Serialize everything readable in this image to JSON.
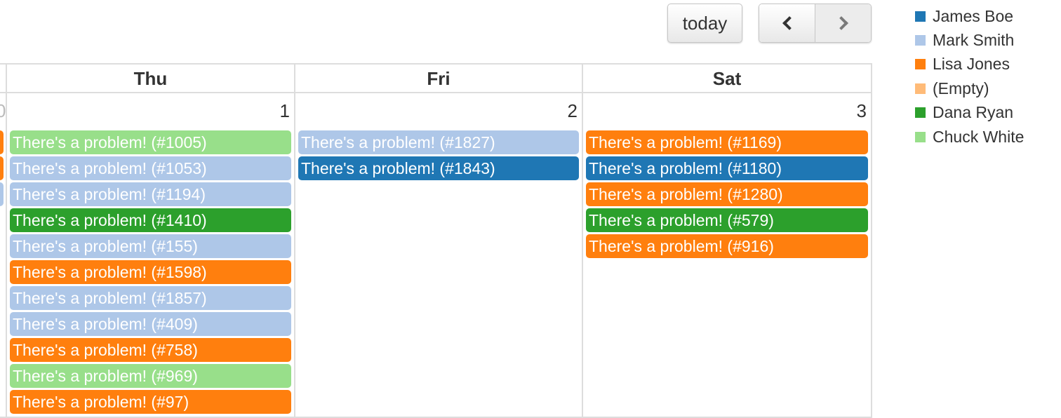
{
  "toolbar": {
    "today_label": "today",
    "prev_icon": "chevron-left",
    "next_icon": "chevron-right"
  },
  "calendar": {
    "columns": [
      {
        "day_name": "Thu",
        "day_number": "1",
        "events": [
          {
            "title": "There's a problem! (#1005)",
            "color": "#98df8a"
          },
          {
            "title": "There's a problem! (#1053)",
            "color": "#aec7e8"
          },
          {
            "title": "There's a problem! (#1194)",
            "color": "#aec7e8"
          },
          {
            "title": "There's a problem! (#1410)",
            "color": "#2ca02c"
          },
          {
            "title": "There's a problem! (#155)",
            "color": "#aec7e8"
          },
          {
            "title": "There's a problem! (#1598)",
            "color": "#ff7f0e"
          },
          {
            "title": "There's a problem! (#1857)",
            "color": "#aec7e8"
          },
          {
            "title": "There's a problem! (#409)",
            "color": "#aec7e8"
          },
          {
            "title": "There's a problem! (#758)",
            "color": "#ff7f0e"
          },
          {
            "title": "There's a problem! (#969)",
            "color": "#98df8a"
          },
          {
            "title": "There's a problem! (#97)",
            "color": "#ff7f0e"
          }
        ]
      },
      {
        "day_name": "Fri",
        "day_number": "2",
        "events": [
          {
            "title": "There's a problem! (#1827)",
            "color": "#aec7e8"
          },
          {
            "title": "There's a problem! (#1843)",
            "color": "#1f77b4"
          }
        ]
      },
      {
        "day_name": "Sat",
        "day_number": "3",
        "events": [
          {
            "title": "There's a problem! (#1169)",
            "color": "#ff7f0e"
          },
          {
            "title": "There's a problem! (#1180)",
            "color": "#1f77b4"
          },
          {
            "title": "There's a problem! (#1280)",
            "color": "#ff7f0e"
          },
          {
            "title": "There's a problem! (#579)",
            "color": "#2ca02c"
          },
          {
            "title": "There's a problem! (#916)",
            "color": "#ff7f0e"
          }
        ]
      }
    ],
    "partial_prev_column": {
      "event_colors": [
        "#ff7f0e",
        "#ff7f0e",
        "#aec7e8"
      ]
    }
  },
  "legend": {
    "items": [
      {
        "label": "James Boe",
        "color": "#1f77b4"
      },
      {
        "label": "Mark Smith",
        "color": "#aec7e8"
      },
      {
        "label": "Lisa Jones",
        "color": "#ff7f0e"
      },
      {
        "label": "(Empty)",
        "color": "#ffbb78"
      },
      {
        "label": "Dana Ryan",
        "color": "#2ca02c"
      },
      {
        "label": "Chuck White",
        "color": "#98df8a"
      }
    ]
  }
}
